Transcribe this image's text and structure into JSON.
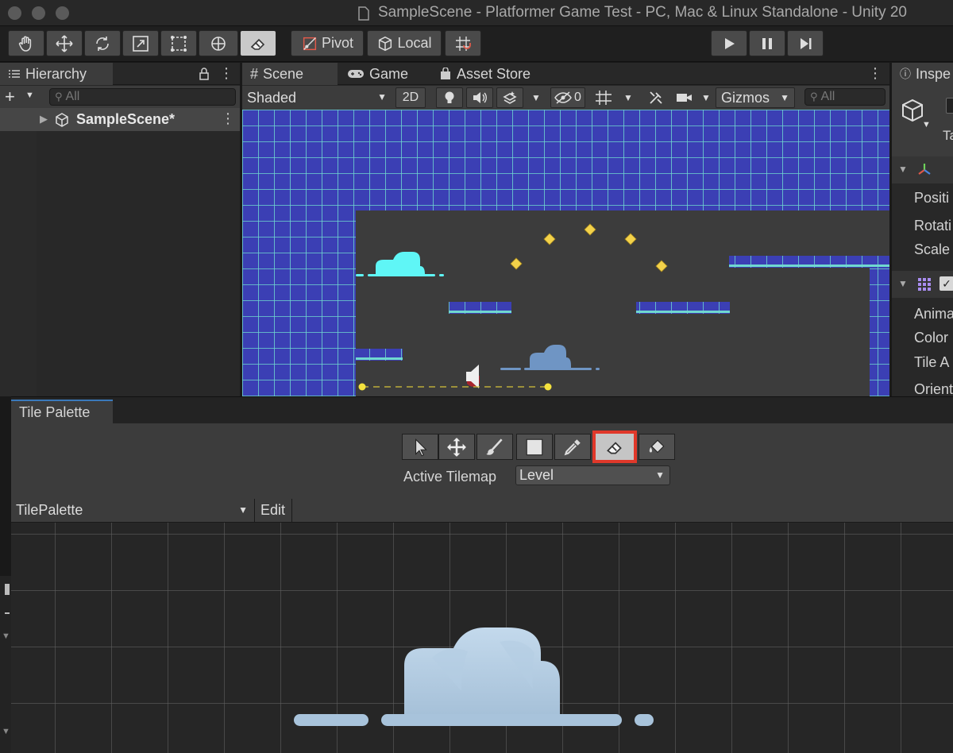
{
  "window": {
    "title": "SampleScene - Platformer Game Test - PC, Mac & Linux Standalone - Unity 20"
  },
  "toolbar": {
    "pivot_label": "Pivot",
    "local_label": "Local"
  },
  "hierarchy": {
    "tab_label": "Hierarchy",
    "search_placeholder": "All",
    "scene_item": "SampleScene*"
  },
  "scene_view": {
    "tabs": [
      {
        "label": "Scene"
      },
      {
        "label": "Game"
      },
      {
        "label": "Asset Store"
      }
    ],
    "shading_mode": "Shaded",
    "mode_2d": "2D",
    "hidden_count": "0",
    "gizmos_label": "Gizmos",
    "search_placeholder": "All"
  },
  "inspector": {
    "tab_label": "Inspe",
    "tag_prefix": "Ta",
    "fields": [
      "Positi",
      "Rotati",
      "Scale",
      "Anima",
      "Color",
      "Tile A",
      "Orient"
    ]
  },
  "tile_palette": {
    "tab_label": "Tile Palette",
    "active_tilemap_label": "Active Tilemap",
    "active_tilemap_value": "Level",
    "palette_name": "TilePalette",
    "edit_label": "Edit",
    "selected_tool": "erase",
    "highlight_color": "#e0382a"
  },
  "colors": {
    "tile_blue": "#3b3fb4",
    "grid_line": "#6fd8cf",
    "cloud_cyan": "#5ff6f6",
    "cloud_blue": "#6f95c4",
    "gem_yellow": "#f3d24a"
  }
}
